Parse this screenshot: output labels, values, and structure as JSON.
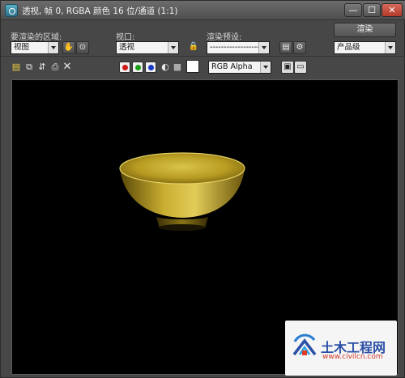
{
  "window": {
    "title": "透视, 帧 0, RGBA 颜色 16 位/通道 (1:1)",
    "min_symbol": "—",
    "max_symbol": "☐",
    "close_symbol": "✕"
  },
  "controls": {
    "area_label": "要渲染的区域:",
    "area_value": "视图",
    "viewport_label": "视口:",
    "viewport_value": "透视",
    "preset_label": "渲染预设:",
    "preset_value": "--------------------------",
    "render_button": "渲染",
    "quality_value": "产品级"
  },
  "toolbar": {
    "channel_value": "RGB Alpha",
    "swatch_color": "#ffffff",
    "channel_dots": [
      "#d01818",
      "#18a018",
      "#1838c8"
    ]
  },
  "viewport": {
    "background": "#000000",
    "object": "bowl",
    "object_color": "#c9b23a"
  },
  "watermark": {
    "title": "土木工程网",
    "url": "www.civilcn.com"
  }
}
